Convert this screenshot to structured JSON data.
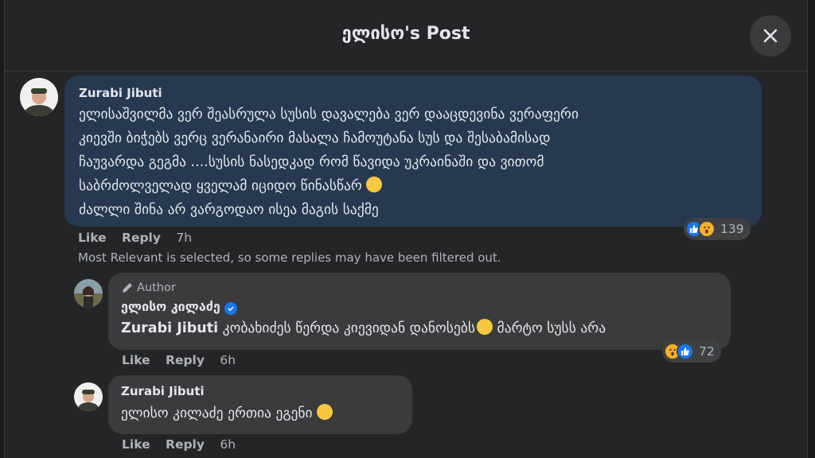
{
  "header": {
    "title": "ელისო's Post"
  },
  "comments": [
    {
      "author": "Zurabi Jibuti",
      "text_lines": [
        "ელისაშვილმა ვერ შეასრულა სუსის დავალება ვერ დააცდევინა ვერაფერი",
        "კიევში ბიჭებს ვერც ვერანაირი მასალა ჩამოუტანა სუს და შესაბამისად",
        "ჩაუვარდა გეგმა ....სუსის ნასედკად რომ წავიდა უკრაინაში და ვითომ",
        "საბრძოლველად ყველამ იციდო წინასწარ",
        "ძალლი შინა არ ვარგოდაო ისეა მაგის საქმე"
      ],
      "like_label": "Like",
      "reply_label": "Reply",
      "time": "7h",
      "reaction_count": "139"
    }
  ],
  "filter_note": "Most Relevant is selected, so some replies may have been filtered out.",
  "replies": [
    {
      "badge": "Author",
      "author": "ელისო კილაძე",
      "mention": "Zurabi Jibuti",
      "text_a": " კობახიძეს წერდა კიევიდან დანოსებს",
      "text_b": " მარტო სუსს არა",
      "like_label": "Like",
      "reply_label": "Reply",
      "time": "6h",
      "reaction_count": "72"
    },
    {
      "author": "Zurabi Jibuti",
      "text": "ელისო კილაძე ერთია ეგენი",
      "like_label": "Like",
      "reply_label": "Reply",
      "time": "6h"
    }
  ],
  "icons": {
    "close": "close-icon",
    "like": "like-reaction-icon",
    "wow": "wow-reaction-icon",
    "pencil": "pencil-icon",
    "verified": "verified-badge-icon"
  },
  "colors": {
    "highlight_bubble": "#263951",
    "bubble": "#3a3b3c",
    "like_blue": "#1877f2",
    "wow_yellow": "#f7b125"
  }
}
